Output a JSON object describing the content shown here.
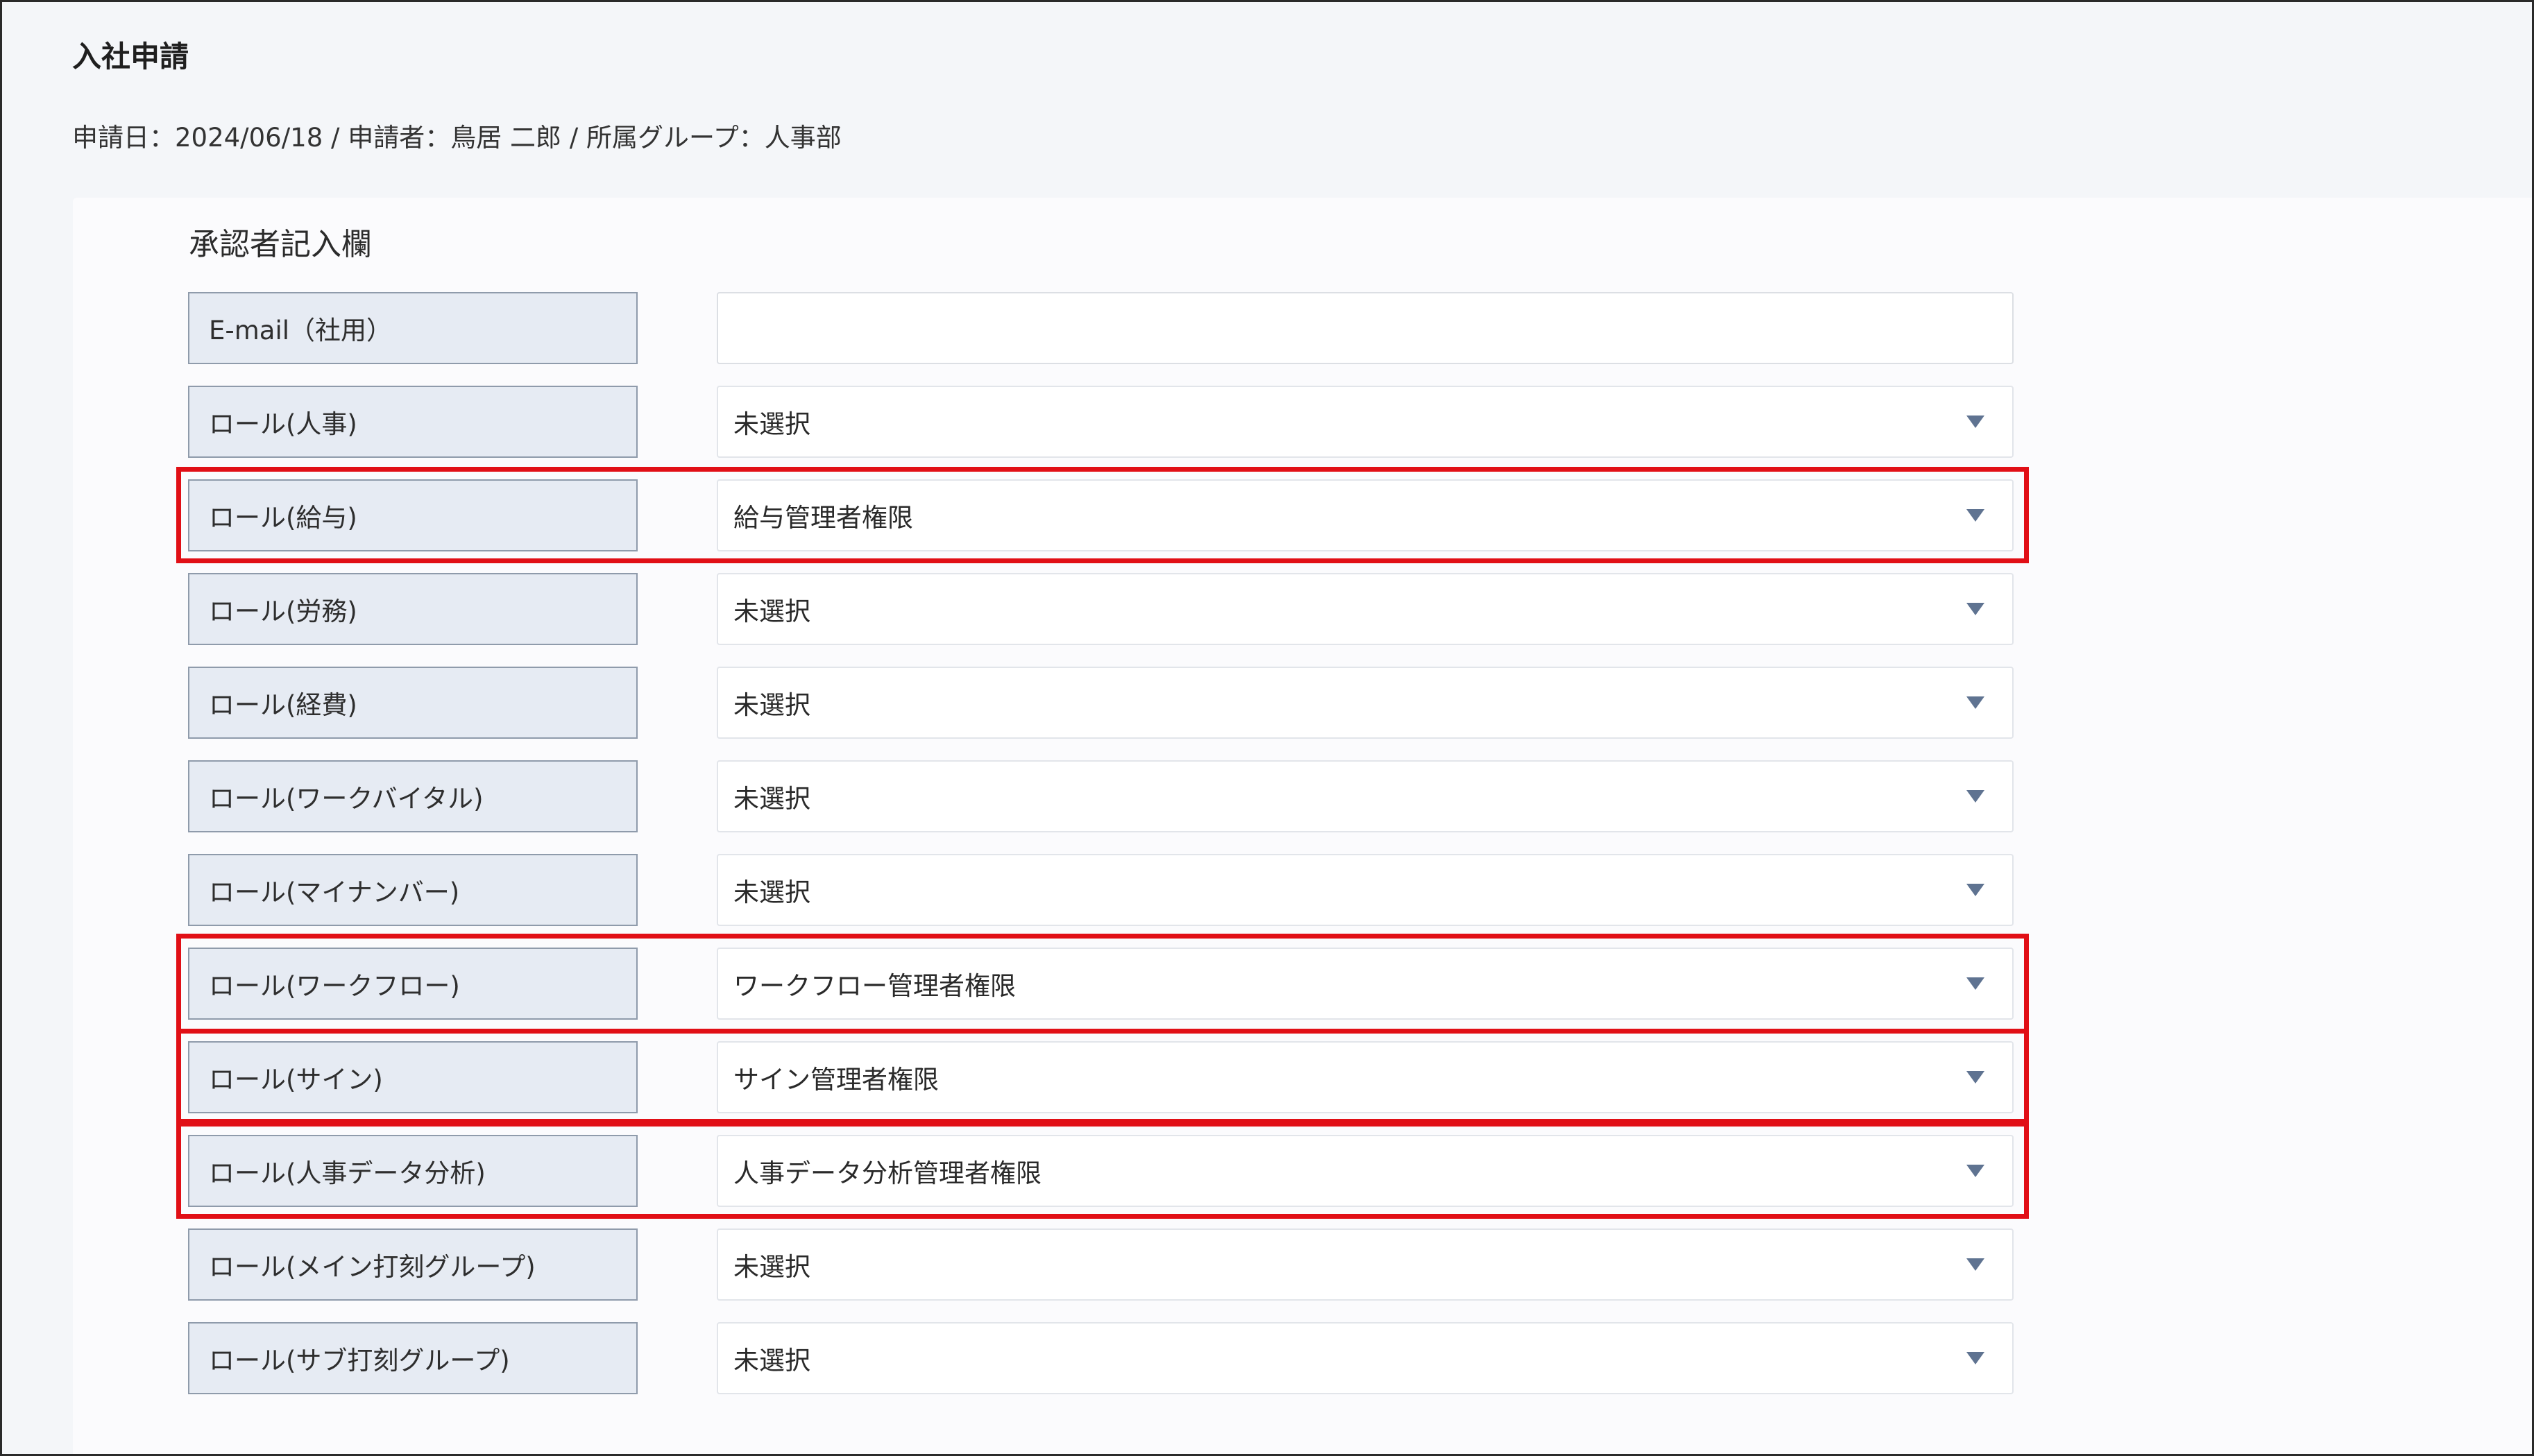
{
  "page": {
    "title": "入社申請",
    "meta": "申請日：2024/06/18 / 申請者：鳥居 二郎 / 所属グループ：人事部"
  },
  "section": {
    "title": "承認者記入欄"
  },
  "rows": [
    {
      "label": "E-mail（社用）",
      "value": ""
    },
    {
      "label": "ロール(人事)",
      "value": "未選択"
    },
    {
      "label": "ロール(給与)",
      "value": "給与管理者権限"
    },
    {
      "label": "ロール(労務)",
      "value": "未選択"
    },
    {
      "label": "ロール(経費)",
      "value": "未選択"
    },
    {
      "label": "ロール(ワークバイタル)",
      "value": "未選択"
    },
    {
      "label": "ロール(マイナンバー)",
      "value": "未選択"
    },
    {
      "label": "ロール(ワークフロー)",
      "value": "ワークフロー管理者権限"
    },
    {
      "label": "ロール(サイン)",
      "value": "サイン管理者権限"
    },
    {
      "label": "ロール(人事データ分析)",
      "value": "人事データ分析管理者権限"
    },
    {
      "label": "ロール(メイン打刻グループ)",
      "value": "未選択"
    },
    {
      "label": "ロール(サブ打刻グループ)",
      "value": "未選択"
    }
  ],
  "colors": {
    "highlight": "#e10f16",
    "label_background": "#e6ebf3",
    "dropdown_caret": "#5f7391"
  },
  "icons": {
    "dropdown": "caret-down-icon"
  }
}
